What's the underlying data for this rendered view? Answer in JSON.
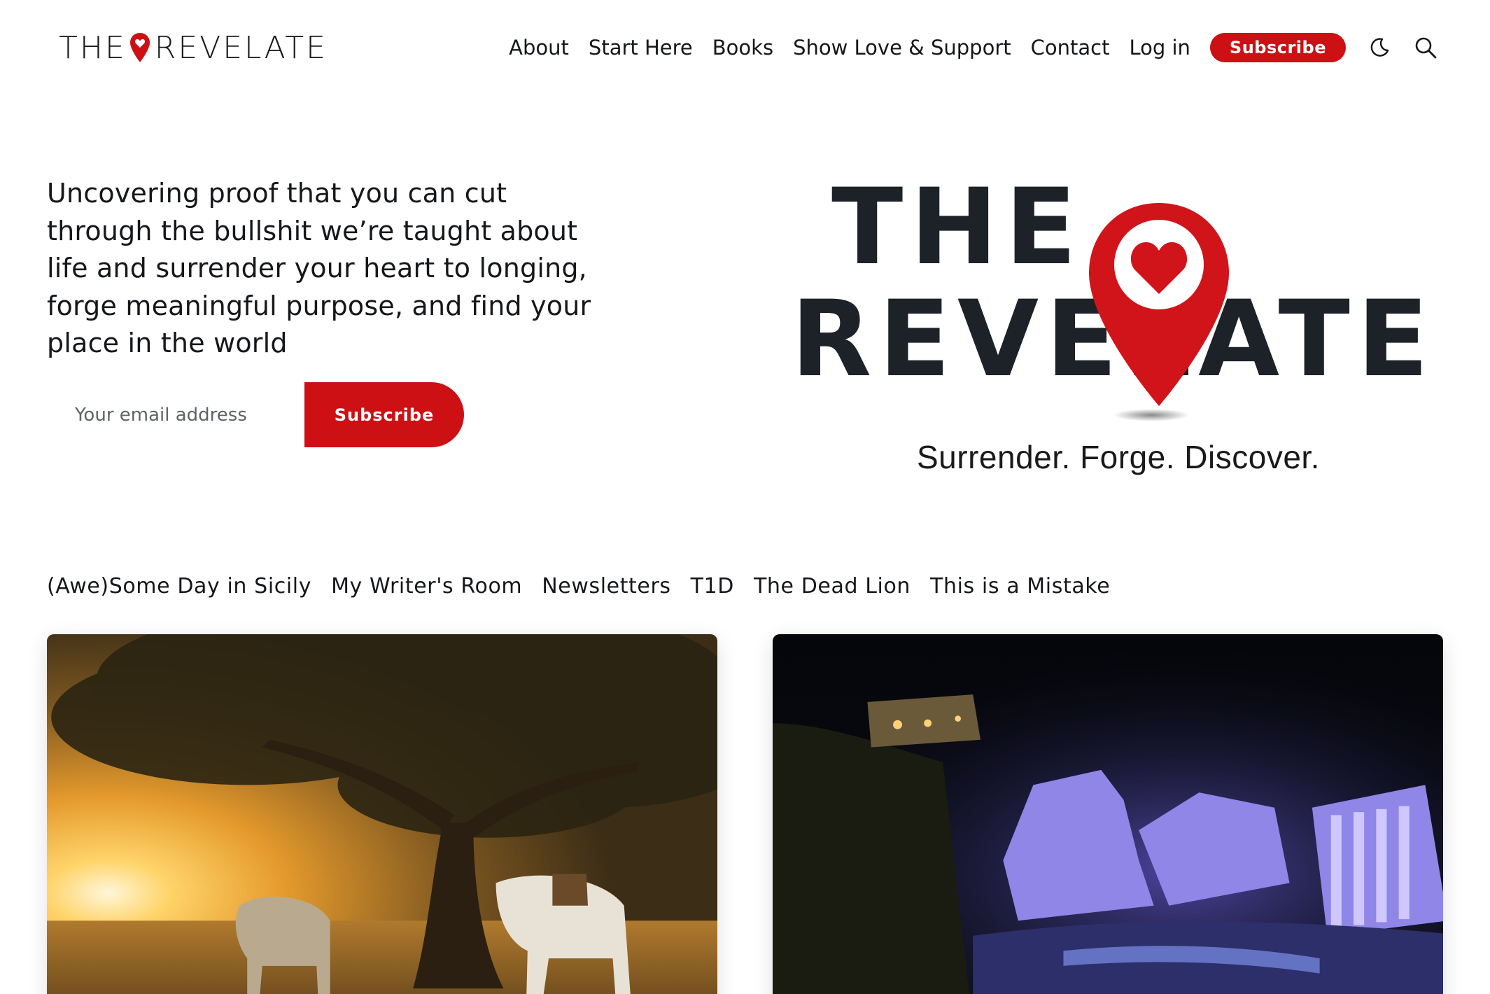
{
  "brand": {
    "name_left": "THE",
    "name_right": "REVELATE",
    "accent": "#cc1014"
  },
  "nav": {
    "items": [
      "About",
      "Start Here",
      "Books",
      "Show Love & Support",
      "Contact",
      "Log in"
    ],
    "subscribe_label": "Subscribe",
    "icons": [
      "moon-icon",
      "search-icon"
    ]
  },
  "hero": {
    "description": "Uncovering proof that you can cut through the bullshit we’re taught about life and surrender your heart to longing, forge meaningful purpose, and find your place in the world",
    "email_placeholder": "Your email address",
    "subscribe_label": "Subscribe",
    "logo": {
      "line1": "THE",
      "line2": "REVELATE",
      "tagline": "Surrender. Forge. Discover."
    }
  },
  "tags": [
    "(Awe)Some Day in Sicily",
    "My Writer's Room",
    "Newsletters",
    "T1D",
    "The Dead Lion",
    "This is a Mistake"
  ],
  "cards": [
    {
      "image": "sunset-tree-horses"
    },
    {
      "image": "illuminated-ancient-theater-night"
    }
  ]
}
